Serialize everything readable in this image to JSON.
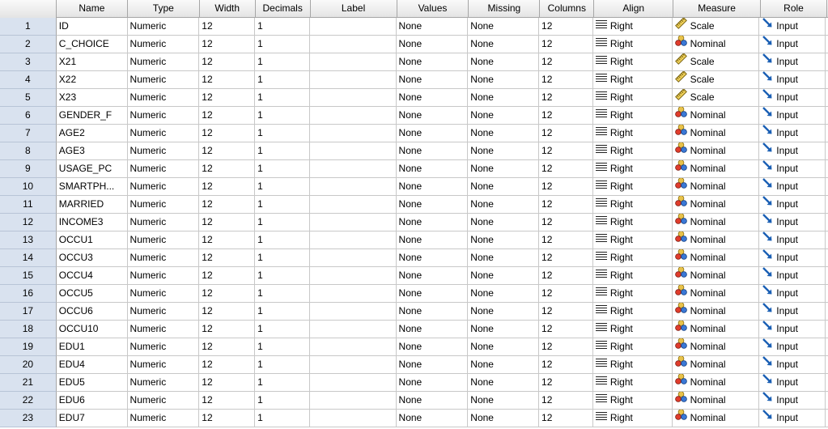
{
  "headers": [
    "Name",
    "Type",
    "Width",
    "Decimals",
    "Label",
    "Values",
    "Missing",
    "Columns",
    "Align",
    "Measure",
    "Role"
  ],
  "rows": [
    {
      "n": "1",
      "name": "ID",
      "type": "Numeric",
      "width": "12",
      "decimals": "1",
      "label": "",
      "values": "None",
      "missing": "None",
      "columns": "12",
      "align": "Right",
      "measure": "Scale",
      "role": "Input"
    },
    {
      "n": "2",
      "name": "C_CHOICE",
      "type": "Numeric",
      "width": "12",
      "decimals": "1",
      "label": "",
      "values": "None",
      "missing": "None",
      "columns": "12",
      "align": "Right",
      "measure": "Nominal",
      "role": "Input"
    },
    {
      "n": "3",
      "name": "X21",
      "type": "Numeric",
      "width": "12",
      "decimals": "1",
      "label": "",
      "values": "None",
      "missing": "None",
      "columns": "12",
      "align": "Right",
      "measure": "Scale",
      "role": "Input"
    },
    {
      "n": "4",
      "name": "X22",
      "type": "Numeric",
      "width": "12",
      "decimals": "1",
      "label": "",
      "values": "None",
      "missing": "None",
      "columns": "12",
      "align": "Right",
      "measure": "Scale",
      "role": "Input"
    },
    {
      "n": "5",
      "name": "X23",
      "type": "Numeric",
      "width": "12",
      "decimals": "1",
      "label": "",
      "values": "None",
      "missing": "None",
      "columns": "12",
      "align": "Right",
      "measure": "Scale",
      "role": "Input"
    },
    {
      "n": "6",
      "name": "GENDER_F",
      "type": "Numeric",
      "width": "12",
      "decimals": "1",
      "label": "",
      "values": "None",
      "missing": "None",
      "columns": "12",
      "align": "Right",
      "measure": "Nominal",
      "role": "Input"
    },
    {
      "n": "7",
      "name": "AGE2",
      "type": "Numeric",
      "width": "12",
      "decimals": "1",
      "label": "",
      "values": "None",
      "missing": "None",
      "columns": "12",
      "align": "Right",
      "measure": "Nominal",
      "role": "Input"
    },
    {
      "n": "8",
      "name": "AGE3",
      "type": "Numeric",
      "width": "12",
      "decimals": "1",
      "label": "",
      "values": "None",
      "missing": "None",
      "columns": "12",
      "align": "Right",
      "measure": "Nominal",
      "role": "Input"
    },
    {
      "n": "9",
      "name": "USAGE_PC",
      "type": "Numeric",
      "width": "12",
      "decimals": "1",
      "label": "",
      "values": "None",
      "missing": "None",
      "columns": "12",
      "align": "Right",
      "measure": "Nominal",
      "role": "Input"
    },
    {
      "n": "10",
      "name": "SMARTPH...",
      "type": "Numeric",
      "width": "12",
      "decimals": "1",
      "label": "",
      "values": "None",
      "missing": "None",
      "columns": "12",
      "align": "Right",
      "measure": "Nominal",
      "role": "Input"
    },
    {
      "n": "11",
      "name": "MARRIED",
      "type": "Numeric",
      "width": "12",
      "decimals": "1",
      "label": "",
      "values": "None",
      "missing": "None",
      "columns": "12",
      "align": "Right",
      "measure": "Nominal",
      "role": "Input"
    },
    {
      "n": "12",
      "name": "INCOME3",
      "type": "Numeric",
      "width": "12",
      "decimals": "1",
      "label": "",
      "values": "None",
      "missing": "None",
      "columns": "12",
      "align": "Right",
      "measure": "Nominal",
      "role": "Input"
    },
    {
      "n": "13",
      "name": "OCCU1",
      "type": "Numeric",
      "width": "12",
      "decimals": "1",
      "label": "",
      "values": "None",
      "missing": "None",
      "columns": "12",
      "align": "Right",
      "measure": "Nominal",
      "role": "Input"
    },
    {
      "n": "14",
      "name": "OCCU3",
      "type": "Numeric",
      "width": "12",
      "decimals": "1",
      "label": "",
      "values": "None",
      "missing": "None",
      "columns": "12",
      "align": "Right",
      "measure": "Nominal",
      "role": "Input"
    },
    {
      "n": "15",
      "name": "OCCU4",
      "type": "Numeric",
      "width": "12",
      "decimals": "1",
      "label": "",
      "values": "None",
      "missing": "None",
      "columns": "12",
      "align": "Right",
      "measure": "Nominal",
      "role": "Input"
    },
    {
      "n": "16",
      "name": "OCCU5",
      "type": "Numeric",
      "width": "12",
      "decimals": "1",
      "label": "",
      "values": "None",
      "missing": "None",
      "columns": "12",
      "align": "Right",
      "measure": "Nominal",
      "role": "Input"
    },
    {
      "n": "17",
      "name": "OCCU6",
      "type": "Numeric",
      "width": "12",
      "decimals": "1",
      "label": "",
      "values": "None",
      "missing": "None",
      "columns": "12",
      "align": "Right",
      "measure": "Nominal",
      "role": "Input"
    },
    {
      "n": "18",
      "name": "OCCU10",
      "type": "Numeric",
      "width": "12",
      "decimals": "1",
      "label": "",
      "values": "None",
      "missing": "None",
      "columns": "12",
      "align": "Right",
      "measure": "Nominal",
      "role": "Input"
    },
    {
      "n": "19",
      "name": "EDU1",
      "type": "Numeric",
      "width": "12",
      "decimals": "1",
      "label": "",
      "values": "None",
      "missing": "None",
      "columns": "12",
      "align": "Right",
      "measure": "Nominal",
      "role": "Input"
    },
    {
      "n": "20",
      "name": "EDU4",
      "type": "Numeric",
      "width": "12",
      "decimals": "1",
      "label": "",
      "values": "None",
      "missing": "None",
      "columns": "12",
      "align": "Right",
      "measure": "Nominal",
      "role": "Input"
    },
    {
      "n": "21",
      "name": "EDU5",
      "type": "Numeric",
      "width": "12",
      "decimals": "1",
      "label": "",
      "values": "None",
      "missing": "None",
      "columns": "12",
      "align": "Right",
      "measure": "Nominal",
      "role": "Input"
    },
    {
      "n": "22",
      "name": "EDU6",
      "type": "Numeric",
      "width": "12",
      "decimals": "1",
      "label": "",
      "values": "None",
      "missing": "None",
      "columns": "12",
      "align": "Right",
      "measure": "Nominal",
      "role": "Input"
    },
    {
      "n": "23",
      "name": "EDU7",
      "type": "Numeric",
      "width": "12",
      "decimals": "1",
      "label": "",
      "values": "None",
      "missing": "None",
      "columns": "12",
      "align": "Right",
      "measure": "Nominal",
      "role": "Input"
    }
  ],
  "icons": {
    "align": "align-right-icon",
    "scale": "ruler-icon",
    "nominal": "three-circles-icon",
    "role": "input-arrow-icon"
  },
  "colors": {
    "row_header_bg": "#d9e2ef",
    "grid_line": "#c8c8c8",
    "header_bg": "#ececec",
    "role_arrow": "#1a5fb4"
  }
}
